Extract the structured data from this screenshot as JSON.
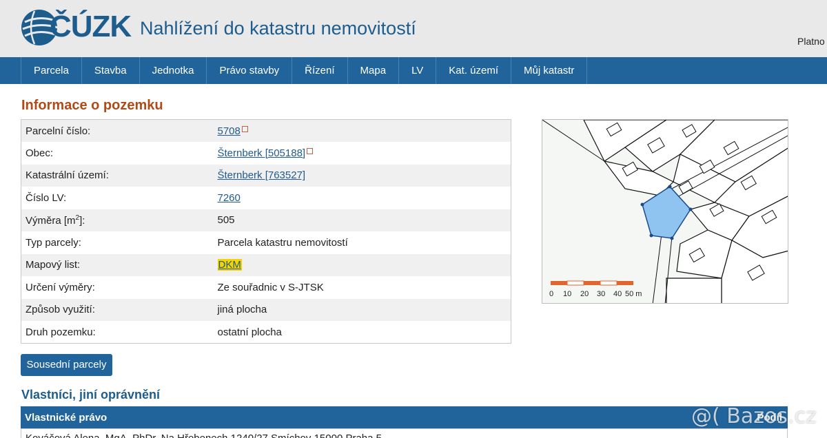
{
  "header": {
    "logo_text": "ČÚZK",
    "site_title": "Nahlížení do katastru nemovitostí",
    "platnost_text": "Platno"
  },
  "nav": {
    "items": [
      "Parcela",
      "Stavba",
      "Jednotka",
      "Právo stavby",
      "Řízení",
      "Mapa",
      "LV",
      "Kat. území",
      "Můj katastr"
    ]
  },
  "main": {
    "title": "Informace o pozemku",
    "rows": [
      {
        "label": "Parcelní číslo:",
        "value": "5708",
        "link": true,
        "external": true
      },
      {
        "label": "Obec:",
        "value": "Šternberk [505188]",
        "link": true,
        "external": true
      },
      {
        "label": "Katastrální území:",
        "value": "Šternberk [763527]",
        "link": true,
        "external": false
      },
      {
        "label": "Číslo LV:",
        "value": "7260",
        "link": true,
        "external": false
      },
      {
        "label_prefix": "Výměra [m",
        "label_sup": "2",
        "label_suffix": "]:",
        "value": "505"
      },
      {
        "label": "Typ parcely:",
        "value": "Parcela katastru nemovitostí"
      },
      {
        "label": "Mapový list:",
        "value": "DKM",
        "link": true,
        "highlight": true
      },
      {
        "label": "Určení výměry:",
        "value": "Ze souřadnic v S-JTSK"
      },
      {
        "label": "Způsob využití:",
        "value": "jiná plocha"
      },
      {
        "label": "Druh pozemku:",
        "value": "ostatní plocha"
      }
    ],
    "neighbors_button": "Sousední parcely",
    "owners_title": "Vlastníci, jiní oprávnění",
    "owners_table": {
      "col_left": "Vlastnické právo",
      "col_right": "Podíl",
      "first_row": "Kováčová Alena, MgA. PhDr. Na Hřebenech 1240/27 Smíchov 15000 Praha 5"
    }
  },
  "map": {
    "scale_labels": [
      "0",
      "10",
      "20",
      "30",
      "40",
      "50 m"
    ],
    "highlight_color": "#8fc3f0",
    "scale_color": "#e0662e"
  },
  "watermark": "@( Bazos.cz"
}
